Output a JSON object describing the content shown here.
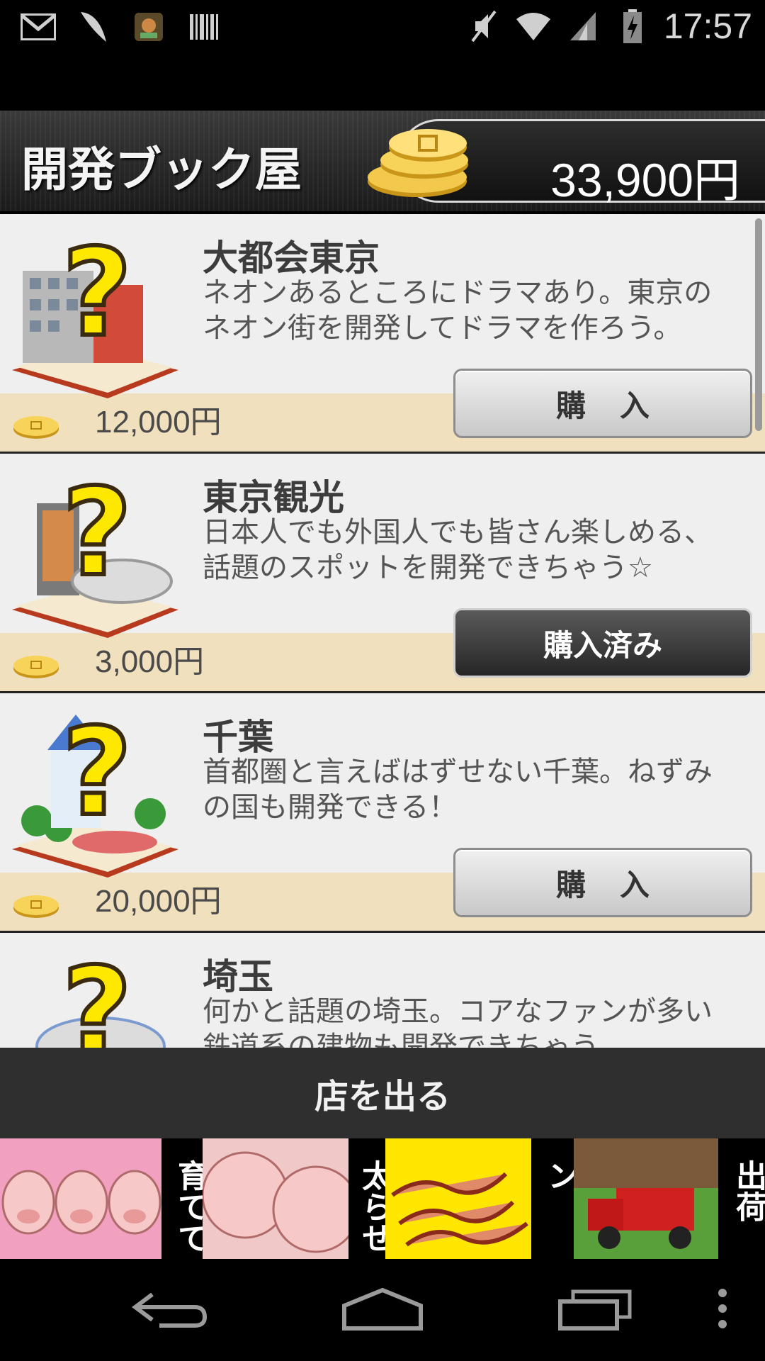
{
  "status_bar": {
    "time": "17:57",
    "icons_left": [
      "gmail-icon",
      "feather-icon",
      "app-notification-icon",
      "barcode-icon"
    ],
    "icons_right": [
      "mute-icon",
      "wifi-icon",
      "signal-icon",
      "battery-charging-icon"
    ]
  },
  "header": {
    "title": "開発ブック屋",
    "money": "33,900円"
  },
  "items": [
    {
      "title": "大都会東京",
      "description": "ネオンあるところにドラマあり。東京のネオン街を開発してドラマを作ろう。",
      "price": "12,000円",
      "button": "購入",
      "purchased": false
    },
    {
      "title": "東京観光",
      "description": "日本人でも外国人でも皆さん楽しめる、話題のスポットを開発できちゃう☆",
      "price": "3,000円",
      "button": "購入済み",
      "purchased": true
    },
    {
      "title": "千葉",
      "description": "首都圏と言えばはずせない千葉。ねずみの国も開発できる！",
      "price": "20,000円",
      "button": "購入",
      "purchased": false
    },
    {
      "title": "埼玉",
      "description": "何かと話題の埼玉。コアなファンが多い鉄道系の建物も開発できちゃう。",
      "price": "",
      "button": "",
      "purchased": false
    }
  ],
  "footer": {
    "leave_label": "店を出る"
  },
  "ad": {
    "labels": [
      "育てて",
      "太らせ",
      "ベーコン",
      "出荷"
    ]
  },
  "colors": {
    "price_band": "#f1e0be",
    "item_bg": "#efefef",
    "header_bg": "#2a2a2a",
    "ad_yellow": "#ffe600"
  }
}
